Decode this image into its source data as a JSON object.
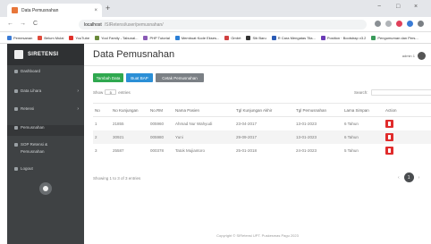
{
  "browser": {
    "tab_title": "Data Pemusnahan",
    "tab_close": "×",
    "new_tab": "+",
    "win_min": "−",
    "win_max": "□",
    "win_close": "×",
    "url_host": "localhost",
    "url_path": "/SIRetensi/user/pemusnahan/",
    "back": "←",
    "forward": "→",
    "reload": "C",
    "bookmarks": [
      {
        "label": "Pemesanan",
        "color": "#3a7bd5"
      },
      {
        "label": "Belum Mulai",
        "color": "#e04a3a"
      },
      {
        "label": "YouTube",
        "color": "#e0302a"
      },
      {
        "label": "Yool Family - Tabunal...",
        "color": "#6a8a3a"
      },
      {
        "label": "PHP Tutorial",
        "color": "#8a5ab5"
      },
      {
        "label": "Membuat Kode Ekses...",
        "color": "#2b7fd5"
      },
      {
        "label": "Gmbrt",
        "color": "#d04040"
      },
      {
        "label": "Sib Baru",
        "color": "#333333"
      },
      {
        "label": "R Cara Mengatas Tila...",
        "color": "#2a5bb5"
      },
      {
        "label": "Position · Bootstrap v3.2",
        "color": "#6a3ab5"
      },
      {
        "label": "Pengumuman dan Pers...",
        "color": "#3a9a5a"
      }
    ]
  },
  "sidebar": {
    "brand": "SIRETENSI",
    "items": [
      {
        "label": [
          "Dashboard"
        ]
      },
      {
        "label": [
          "Data Lihara"
        ],
        "chevron": "›"
      },
      {
        "label": [
          "Retensi"
        ],
        "chevron": "›"
      },
      {
        "label": [
          "Pemusnahan"
        ]
      },
      {
        "label": [
          "SOP Retensi &",
          "Pemusnahan"
        ]
      },
      {
        "label": [
          "Logout"
        ]
      }
    ]
  },
  "header": {
    "title": "Data Pemusnahan",
    "user": "admin 1"
  },
  "actions": {
    "add": "Tambah Data",
    "bap": "Buat BAP",
    "print": "Cetak Pemusnahan"
  },
  "table_controls": {
    "show_prefix": "Show",
    "show_value": "5",
    "show_suffix": "entries",
    "search_label": "Search:"
  },
  "table": {
    "columns": [
      "No",
      "No Kunjungan",
      "No.RM",
      "Nama Pasien",
      "Tgl Kunjungan Akhir",
      "Tgl Pemusnahan",
      "Lama Simpan",
      "Action"
    ],
    "rows": [
      [
        "1",
        "21855",
        "005960",
        "Ahmad Nur Wahyudi",
        "23-04-2017",
        "13-01-2023",
        "6 Tahun"
      ],
      [
        "2",
        "30921",
        "005980",
        "Yuni",
        "29-09-2017",
        "13-01-2023",
        "6 Tahun"
      ],
      [
        "3",
        "25587",
        "000378",
        "Tatok Mujiantoro",
        "25-01-2018",
        "24-01-2023",
        "5 Tahun"
      ]
    ]
  },
  "pagination": {
    "info": "Showing 1 to 3 of 3 entries",
    "prev": "‹",
    "current": "1",
    "next": "›"
  },
  "footer": "Copyright © SIRetensi UPT. Puskesmas Pagu 2023"
}
